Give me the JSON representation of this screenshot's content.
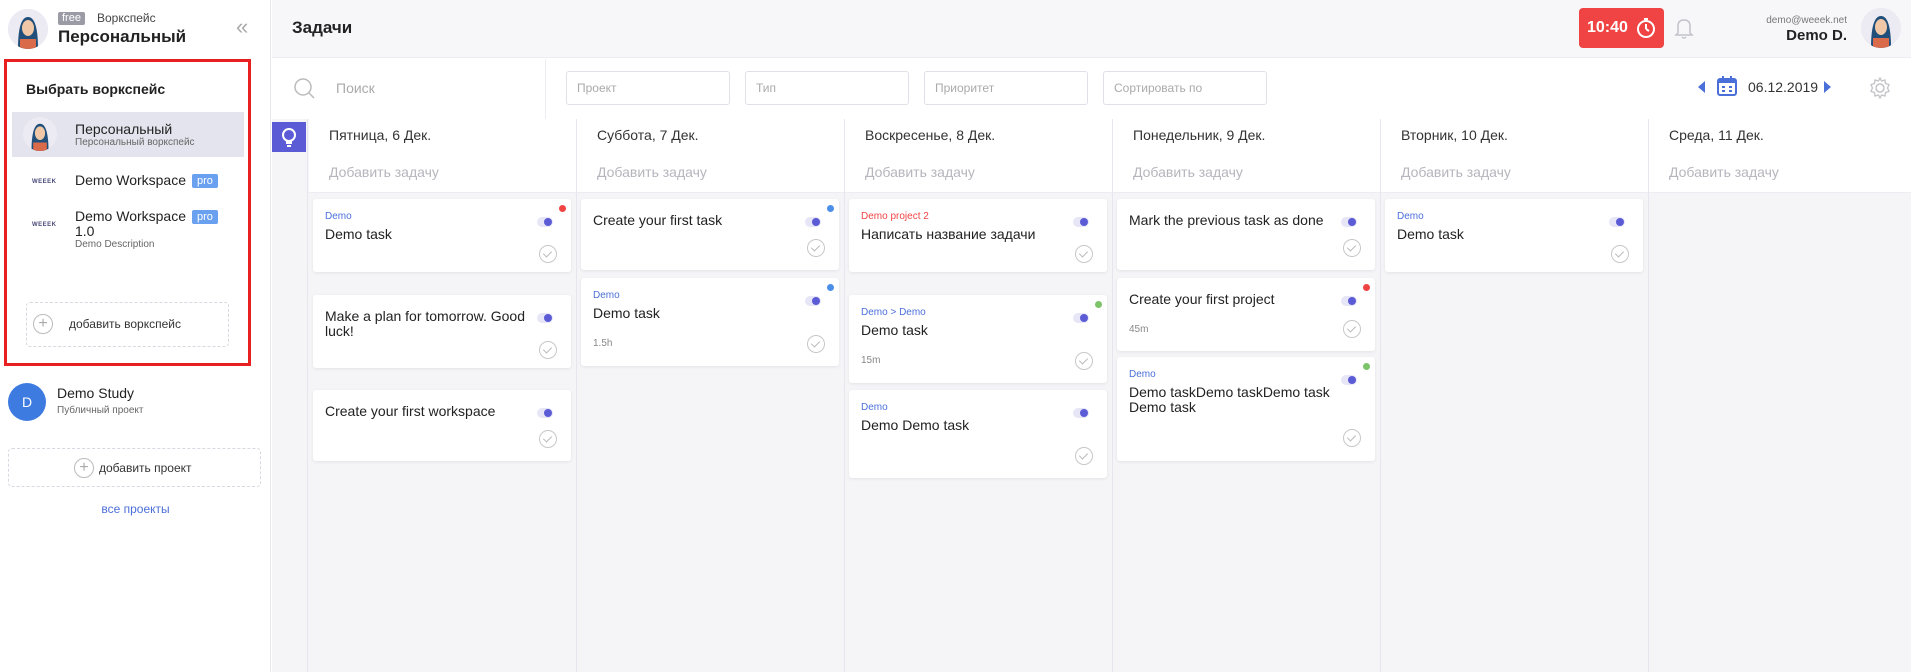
{
  "workspace": {
    "badge": "free",
    "kind": "Воркспейс",
    "name": "Персональный"
  },
  "dropdown": {
    "title": "Выбрать воркспейс",
    "items": [
      {
        "name": "Персональный",
        "desc": "Персональный воркспейс"
      },
      {
        "name": "Demo Workspace",
        "badge": "pro"
      },
      {
        "name_line1": "Demo Workspace",
        "name_line2": "1.0",
        "badge": "pro",
        "desc": "Demo Description"
      }
    ],
    "add_label": "добавить воркспейс"
  },
  "project": {
    "initial": "D",
    "name": "Demo Study",
    "desc": "Публичный проект"
  },
  "sidebar": {
    "add_project": "добавить проект",
    "all_projects": "все проекты"
  },
  "header": {
    "title": "Задачи",
    "timer": "10:40",
    "email": "demo@weeek.net",
    "user": "Demo D."
  },
  "filters": {
    "search_placeholder": "Поиск",
    "project_placeholder": "Проект",
    "type_placeholder": "Тип",
    "priority_placeholder": "Приоритет",
    "sort_placeholder": "Сортировать по",
    "date": "06.12.2019"
  },
  "colors": {
    "accent": "#4b6fd8",
    "timer": "#f04343",
    "highlight": "#e82020",
    "priority_red": "#f04343",
    "priority_blue": "#4b8fe8",
    "priority_green": "#7cc36a"
  },
  "board": {
    "add_task": "Добавить задачу",
    "columns": [
      {
        "day": "Пятница, 6 Дек.",
        "cards": [
          {
            "project": "Demo",
            "title": "Demo task"
          },
          {
            "title": "Make a plan for tomorrow. Good luck!"
          },
          {
            "title": "Create your first workspace"
          }
        ]
      },
      {
        "day": "Суббота, 7 Дек.",
        "cards": [
          {
            "title": "Create your first task"
          },
          {
            "project": "Demo",
            "title": "Demo task",
            "estimate": "1.5h"
          }
        ]
      },
      {
        "day": "Воскресенье, 8 Дек.",
        "cards": [
          {
            "project": "Demo project 2",
            "title": "Написать название задачи"
          },
          {
            "project": "Demo > Demo",
            "title": "Demo task",
            "estimate": "15m"
          },
          {
            "project": "Demo",
            "title": "Demo Demo task"
          }
        ]
      },
      {
        "day": "Понедельник, 9 Дек.",
        "cards": [
          {
            "title": "Mark the previous task as done"
          },
          {
            "title": "Create your first project",
            "estimate": "45m"
          },
          {
            "project": "Demo",
            "title": "Demo taskDemo taskDemo task Demo task"
          }
        ]
      },
      {
        "day": "Вторник, 10 Дек.",
        "cards": [
          {
            "project": "Demo",
            "title": "Demo task"
          }
        ]
      },
      {
        "day": "Среда, 11 Дек.",
        "cards": []
      }
    ]
  }
}
